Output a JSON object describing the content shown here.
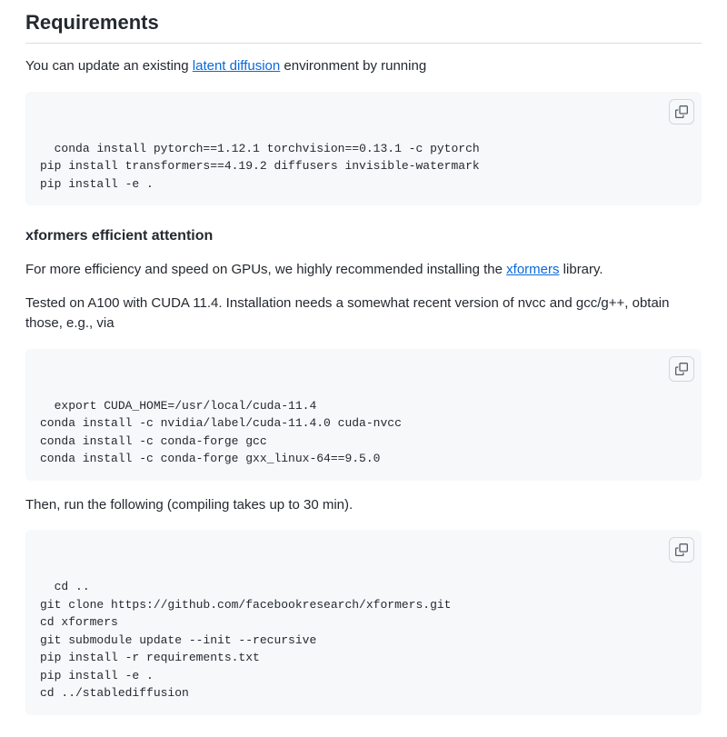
{
  "heading": "Requirements",
  "intro_parts": {
    "before": "You can update an existing ",
    "link": "latent diffusion",
    "after": " environment by running"
  },
  "code1": "conda install pytorch==1.12.1 torchvision==0.13.1 -c pytorch\npip install transformers==4.19.2 diffusers invisible-watermark\npip install -e .",
  "subheading": "xformers efficient attention",
  "p2_parts": {
    "before": "For more efficiency and speed on GPUs, we highly recommended installing the ",
    "link": "xformers",
    "after": " library."
  },
  "p3": "Tested on A100 with CUDA 11.4. Installation needs a somewhat recent version of nvcc and gcc/g++, obtain those, e.g., via",
  "code2": "export CUDA_HOME=/usr/local/cuda-11.4\nconda install -c nvidia/label/cuda-11.4.0 cuda-nvcc\nconda install -c conda-forge gcc\nconda install -c conda-forge gxx_linux-64==9.5.0",
  "p4": "Then, run the following (compiling takes up to 30 min).",
  "code3": "cd ..\ngit clone https://github.com/facebookresearch/xformers.git\ncd xformers\ngit submodule update --init --recursive\npip install -r requirements.txt\npip install -e .\ncd ../stablediffusion"
}
